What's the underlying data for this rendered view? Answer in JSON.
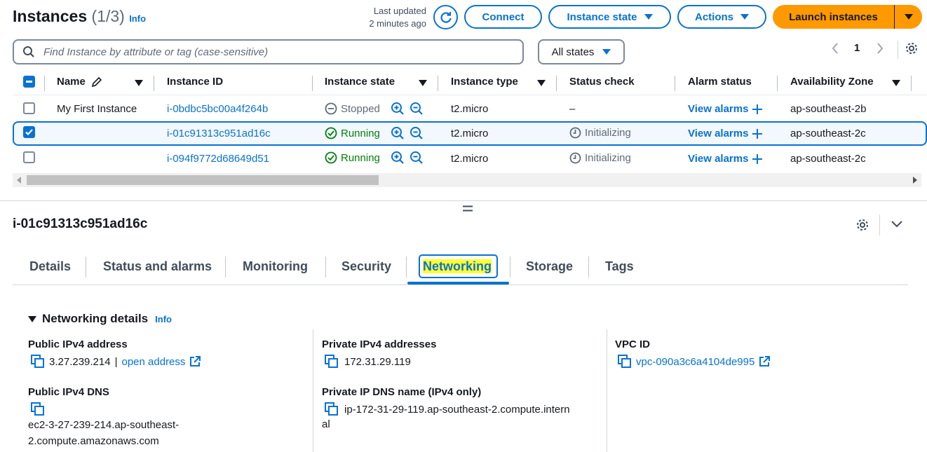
{
  "header": {
    "title": "Instances",
    "count": "(1/3)",
    "info": "Info",
    "last_updated_line1": "Last updated",
    "last_updated_line2": "2 minutes ago",
    "connect": "Connect",
    "instance_state": "Instance state",
    "actions": "Actions",
    "launch": "Launch instances"
  },
  "filter": {
    "search_placeholder": "Find Instance by attribute or tag (case-sensitive)",
    "states_value": "All states",
    "page": "1"
  },
  "table": {
    "columns": [
      "Name",
      "Instance ID",
      "Instance state",
      "Instance type",
      "Status check",
      "Alarm status",
      "Availability Zone"
    ],
    "rows": [
      {
        "checked": false,
        "name": "My First Instance",
        "id": "i-0bdbc5bc00a4f264b",
        "state": "Stopped",
        "type": "t2.micro",
        "status": "–",
        "alarm": "View alarms",
        "az": "ap-southeast-2b"
      },
      {
        "checked": true,
        "name": "",
        "id": "i-01c91313c951ad16c",
        "state": "Running",
        "type": "t2.micro",
        "status": "Initializing",
        "alarm": "View alarms",
        "az": "ap-southeast-2c"
      },
      {
        "checked": false,
        "name": "",
        "id": "i-094f9772d68649d51",
        "state": "Running",
        "type": "t2.micro",
        "status": "Initializing",
        "alarm": "View alarms",
        "az": "ap-southeast-2c"
      }
    ]
  },
  "details": {
    "instance_id": "i-01c91313c951ad16c",
    "tabs": [
      "Details",
      "Status and alarms",
      "Monitoring",
      "Security",
      "Networking",
      "Storage",
      "Tags"
    ],
    "active_tab": "Networking",
    "section_title": "Networking details",
    "section_info": "Info",
    "public_ipv4_label": "Public IPv4 address",
    "public_ipv4_value": "3.27.239.214",
    "public_ipv4_sep": "|",
    "open_address": "open address",
    "public_dns_label": "Public IPv4 DNS",
    "public_dns_line1": "ec2-3-27-239-214.ap-southeast-",
    "public_dns_line2": "2.compute.amazonaws.com",
    "private_ipv4_label": "Private IPv4 addresses",
    "private_ipv4_value": "172.31.29.119",
    "private_dns_label": "Private IP DNS name (IPv4 only)",
    "private_dns_line1": "ip-172-31-29-119.ap-southeast-2.compute.intern",
    "private_dns_line2": "al",
    "vpc_label": "VPC ID",
    "vpc_value": "vpc-090a3c6a4104de995"
  },
  "colors": {
    "accent": "#0972d3",
    "launch": "#ff9900",
    "running": "#037f0c",
    "highlight": "#ffff33"
  }
}
